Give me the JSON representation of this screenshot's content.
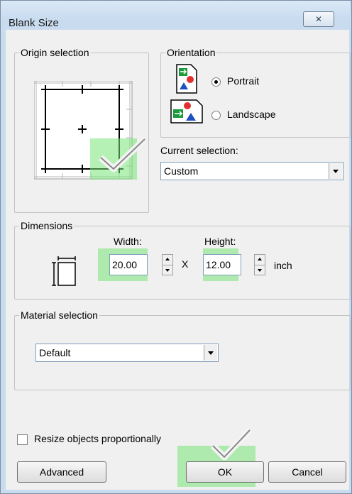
{
  "window": {
    "title": "Blank Size",
    "close_glyph": "✕"
  },
  "origin": {
    "legend": "Origin selection"
  },
  "orientation": {
    "legend": "Orientation",
    "options": [
      {
        "label": "Portrait",
        "selected": true,
        "icon": "portrait-page-icon"
      },
      {
        "label": "Landscape",
        "selected": false,
        "icon": "landscape-page-icon"
      }
    ]
  },
  "current_selection": {
    "label": "Current selection:",
    "value": "Custom"
  },
  "dimensions": {
    "legend": "Dimensions",
    "width_label": "Width:",
    "width_value": "20.00",
    "times_symbol": "X",
    "height_label": "Height:",
    "height_value": "12.00",
    "unit": "inch"
  },
  "material": {
    "legend": "Material selection",
    "value": "Default"
  },
  "resize": {
    "label": "Resize objects proportionally",
    "checked": false
  },
  "buttons": {
    "advanced": "Advanced",
    "ok": "OK",
    "cancel": "Cancel"
  },
  "colors": {
    "highlight": "#7ee07e",
    "client_bg": "#f0f0f0",
    "frame": "#c9dcef"
  }
}
